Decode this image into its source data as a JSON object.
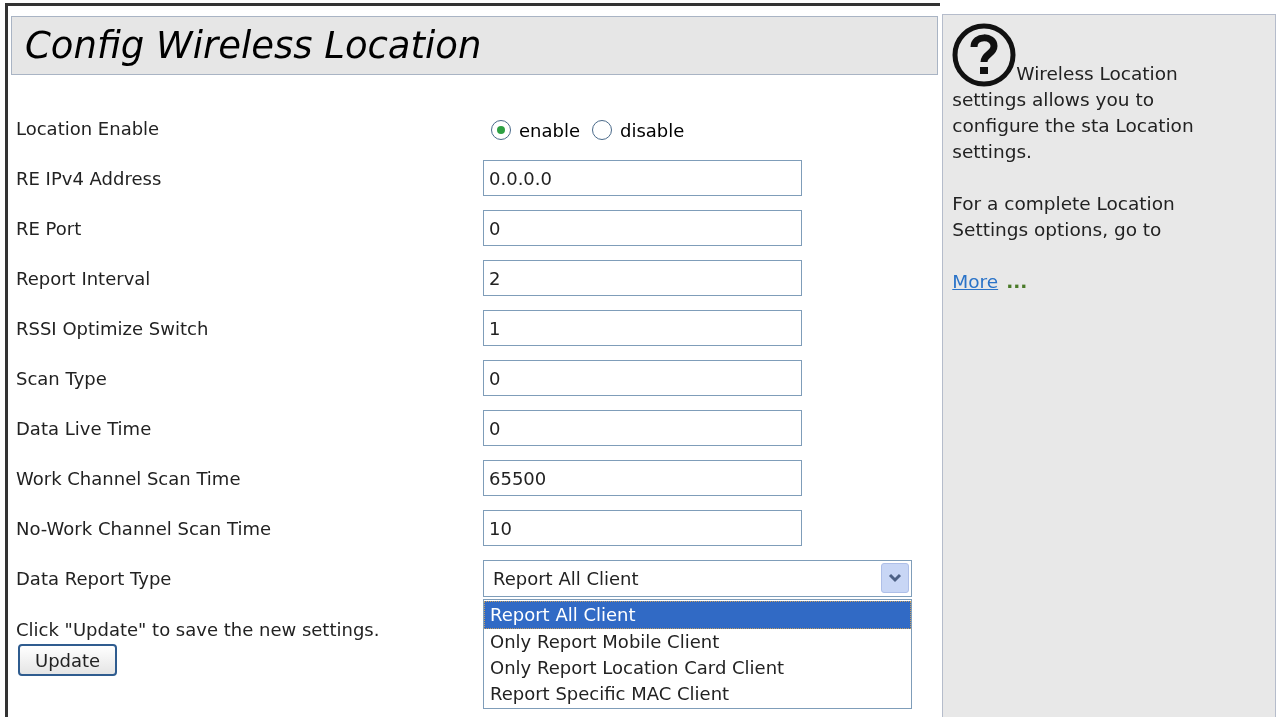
{
  "title": "Config Wireless Location",
  "fields": [
    {
      "kind": "radio",
      "label": "Location Enable",
      "options": [
        {
          "label": "enable",
          "selected": true
        },
        {
          "label": "disable",
          "selected": false
        }
      ]
    },
    {
      "kind": "text",
      "label": "RE IPv4 Address",
      "value": "0.0.0.0"
    },
    {
      "kind": "text",
      "label": "RE Port",
      "value": "0"
    },
    {
      "kind": "text",
      "label": "Report Interval",
      "value": "2"
    },
    {
      "kind": "text",
      "label": "RSSI Optimize Switch",
      "value": "1"
    },
    {
      "kind": "text",
      "label": "Scan Type",
      "value": "0"
    },
    {
      "kind": "text",
      "label": "Data Live Time",
      "value": "0"
    },
    {
      "kind": "text",
      "label": "Work Channel Scan Time",
      "value": "65500"
    },
    {
      "kind": "text",
      "label": "No-Work Channel Scan Time",
      "value": "10"
    },
    {
      "kind": "select",
      "label": "Data Report Type",
      "value": "Report All Client",
      "expanded": true,
      "options": [
        {
          "label": "Report All Client",
          "selected": true
        },
        {
          "label": "Only Report Mobile Client",
          "selected": false
        },
        {
          "label": "Only Report Location Card Client",
          "selected": false
        },
        {
          "label": "Report Specific MAC Client",
          "selected": false
        }
      ]
    }
  ],
  "instruction": "Click \"Update\" to save the new settings.",
  "update_button": "Update",
  "help": {
    "paragraphs": [
      "Wireless Location settings allows you to configure the sta Location settings.",
      "For a complete Location Settings options, go to"
    ],
    "link": "More",
    "link_suffix": "..."
  }
}
